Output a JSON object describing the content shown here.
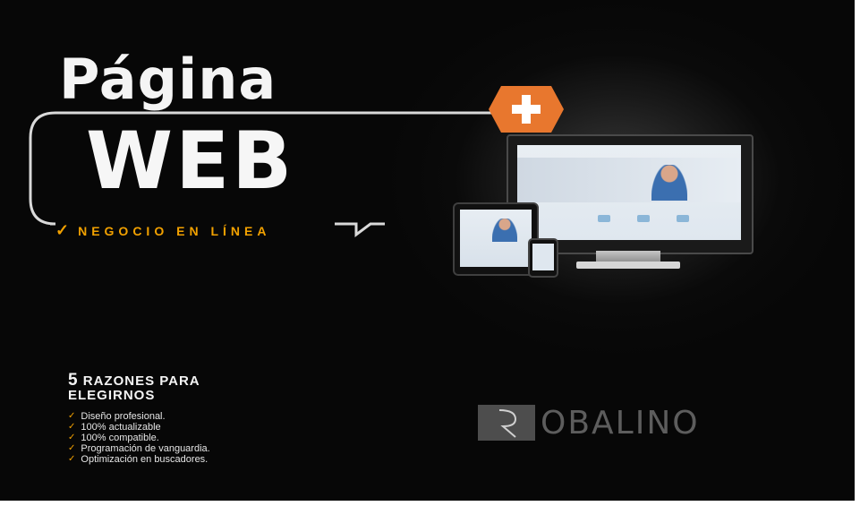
{
  "headline": {
    "line1": "Página",
    "line2": "WEB",
    "tagline": "NEGOCIO EN LÍNEA"
  },
  "reasons": {
    "number": "5",
    "title_line1": " RAZONES PARA",
    "title_line2": "ELEGIRNOS",
    "items": [
      "Diseño profesional.",
      "100% actualizable",
      "100% compatible.",
      "Programación de vanguardia.",
      "Optimización en buscadores."
    ]
  },
  "logo": {
    "name": "OBALINO"
  },
  "colors": {
    "accent": "#f2a100",
    "badge": "#e8772e",
    "background": "#0a0a0a",
    "text": "#f4f4f4"
  },
  "icons": [
    "plus-icon",
    "check-icon",
    "monitor-icon",
    "tablet-icon",
    "phone-icon"
  ]
}
